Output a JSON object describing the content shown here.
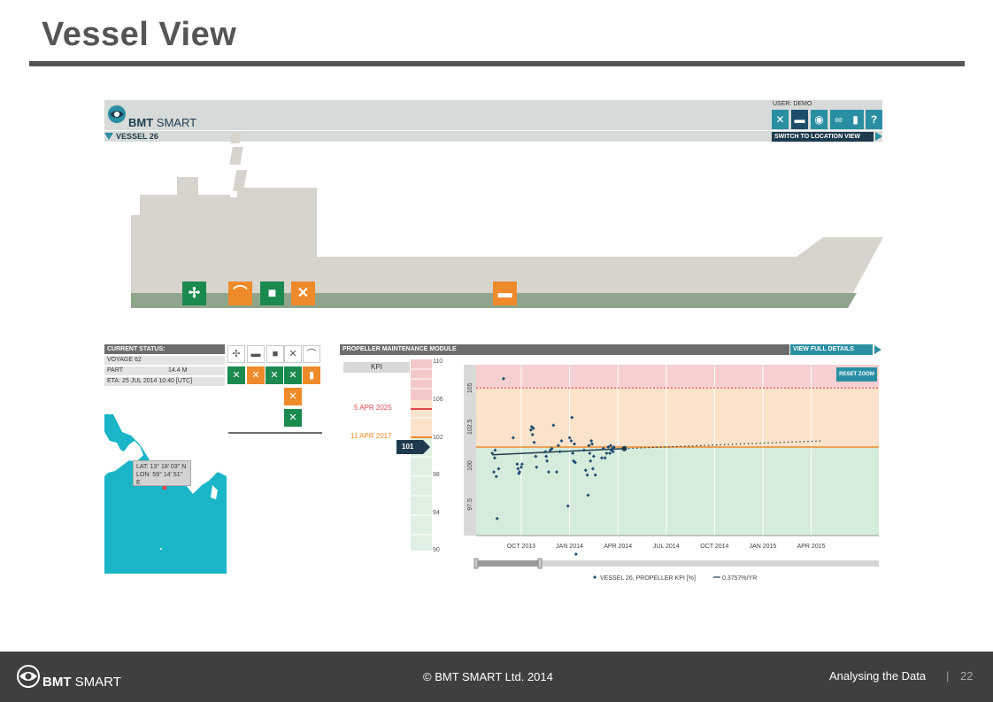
{
  "slide": {
    "title": "Vessel View",
    "footer": {
      "logo_bold": "BMT",
      "logo_light": "SMART",
      "copyright": "© BMT SMART Ltd. 2014",
      "section": "Analysing the Data",
      "separator": "|",
      "page_number": "22"
    }
  },
  "app": {
    "logo_bold": "BMT",
    "logo_light": "SMART",
    "user_label": "USER: DEMO",
    "vessel_name": "VESSEL 26",
    "switch_label": "SWITCH TO LOCATION VIEW",
    "toolbar_icons": [
      "tools-icon",
      "ship-icon",
      "compass-icon",
      "modules-icon",
      "chart-icon",
      "help-icon"
    ],
    "colors": {
      "teal": "#2a8fa3",
      "navy": "#1e3b4e",
      "green": "#1a8a4f",
      "orange": "#ee8a2a"
    }
  },
  "ship": {
    "system_icons": [
      {
        "name": "propeller-icon",
        "status": "green"
      },
      {
        "name": "performance-curve-icon",
        "status": "orange"
      },
      {
        "name": "engine-icon",
        "status": "green"
      },
      {
        "name": "maintenance-tools-icon",
        "status": "orange"
      },
      {
        "name": "hull-icon",
        "status": "orange"
      }
    ]
  },
  "status": {
    "header": "CURRENT STATUS:",
    "voyage": "VOYAGE 62",
    "part_label": "PART",
    "part_value": "14.4 M",
    "eta_label": "ETA:",
    "eta_value": "25 JUL 2014 10:40 [UTC]",
    "lat": "LAT: 13° 18' 03\" N",
    "lon": "LON: 59° 14' 51\"",
    "lon_dir": "E"
  },
  "module": {
    "header": "PROPELLER MAINTENANCE MODULE",
    "details_button": "VIEW FULL DETAILS",
    "reset_zoom": "RESET ZOOM",
    "kpi_label": "KPI",
    "kpi_value": "101",
    "date_red": "5 APR 2025",
    "date_orange": "11 APR 2017",
    "gauge_ticks": [
      "110",
      "106",
      "102",
      "98",
      "94",
      "90"
    ]
  },
  "chart_data": {
    "type": "scatter",
    "x_ticks": [
      "OCT 2013",
      "JAN 2014",
      "APR 2014",
      "JUL 2014",
      "OCT 2014",
      "JAN 2015",
      "APR 2015"
    ],
    "y_ticks": [
      "97.5",
      "100",
      "102.5",
      "105"
    ],
    "ylim": [
      95.5,
      106.5
    ],
    "red_threshold": 105,
    "orange_threshold": 101.2,
    "series": [
      {
        "name": "VESSEL 26, PROPELLER KPI [%]",
        "points": [
          [
            0.0,
            100.8
          ],
          [
            0.1,
            99.6
          ],
          [
            0.15,
            100.5
          ],
          [
            0.18,
            101.0
          ],
          [
            0.25,
            99.3
          ],
          [
            0.3,
            96.6
          ],
          [
            0.4,
            99.8
          ],
          [
            0.7,
            105.6
          ],
          [
            1.3,
            101.8
          ],
          [
            1.55,
            100.1
          ],
          [
            1.6,
            99.8
          ],
          [
            1.65,
            99.5
          ],
          [
            1.7,
            99.6
          ],
          [
            1.8,
            99.9
          ],
          [
            1.85,
            100.1
          ],
          [
            2.4,
            102.3
          ],
          [
            2.45,
            102.5
          ],
          [
            2.5,
            102.0
          ],
          [
            2.55,
            102.4
          ],
          [
            2.6,
            101.5
          ],
          [
            2.7,
            100.6
          ],
          [
            2.75,
            99.9
          ],
          [
            3.3,
            100.9
          ],
          [
            3.35,
            100.6
          ],
          [
            3.4,
            100.3
          ],
          [
            3.5,
            99.6
          ],
          [
            3.6,
            101.0
          ],
          [
            3.7,
            101.1
          ],
          [
            3.8,
            102.6
          ],
          [
            4.0,
            99.6
          ],
          [
            4.1,
            101.3
          ],
          [
            4.2,
            100.9
          ],
          [
            4.3,
            101.6
          ],
          [
            4.7,
            97.4
          ],
          [
            4.8,
            101.8
          ],
          [
            4.9,
            101.6
          ],
          [
            4.95,
            103.1
          ],
          [
            5.0,
            100.8
          ],
          [
            5.05,
            100.3
          ],
          [
            5.1,
            101.4
          ],
          [
            5.15,
            100.2
          ],
          [
            5.2,
            94.3
          ],
          [
            5.7,
            101.0
          ],
          [
            5.8,
            99.7
          ],
          [
            5.9,
            99.4
          ],
          [
            5.95,
            98.1
          ],
          [
            6.0,
            101.3
          ],
          [
            6.05,
            100.8
          ],
          [
            6.1,
            100.3
          ],
          [
            6.15,
            101.6
          ],
          [
            6.2,
            101.4
          ],
          [
            6.25,
            99.8
          ],
          [
            6.3,
            100.6
          ],
          [
            6.4,
            99.4
          ],
          [
            6.8,
            100.5
          ],
          [
            6.9,
            101.1
          ],
          [
            7.0,
            100.5
          ],
          [
            7.1,
            100.8
          ],
          [
            7.2,
            101.2
          ],
          [
            7.3,
            100.8
          ],
          [
            7.35,
            101.3
          ],
          [
            7.4,
            101.0
          ],
          [
            7.45,
            101.1
          ],
          [
            7.5,
            100.9
          ],
          [
            7.55,
            101.2
          ]
        ]
      }
    ],
    "trend": {
      "name": "0.3757%/YR",
      "x0": 0.0,
      "y0": 100.7,
      "x1": 8.2,
      "y1": 101.1,
      "projection_end_x": 20.5,
      "projection_end_y": 101.6
    },
    "legend_position": "bottom"
  }
}
